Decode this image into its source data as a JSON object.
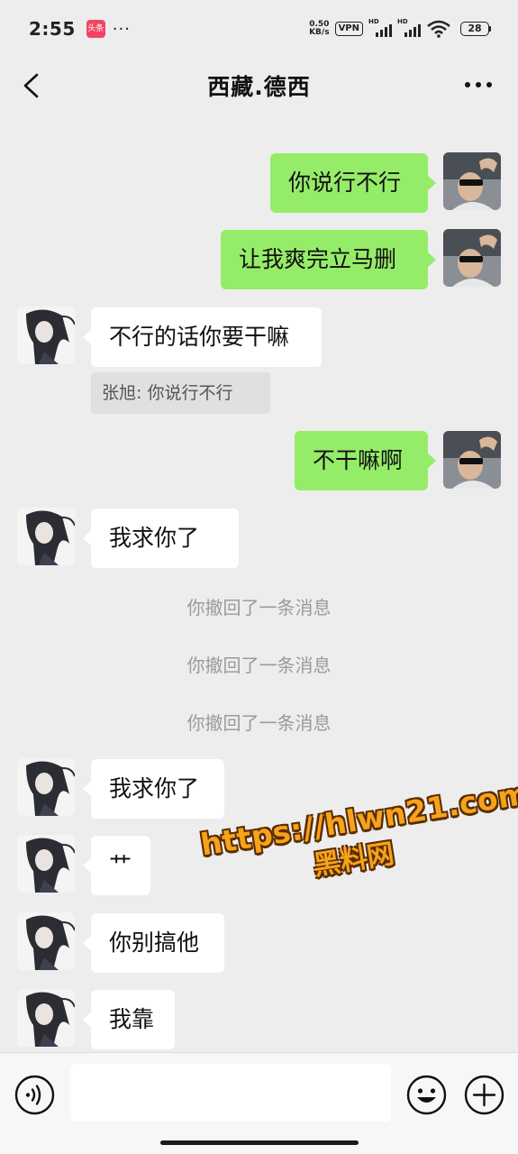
{
  "status_bar": {
    "time": "2:55",
    "app_badge": "头条",
    "more": "···",
    "net_speed_value": "0.50",
    "net_speed_unit": "KB/s",
    "vpn": "VPN",
    "hd1": "HD",
    "hd2": "HD",
    "battery": "28"
  },
  "header": {
    "title": "西藏.德西"
  },
  "messages": [
    {
      "side": "right",
      "text": "你说行不行",
      "avatar": "avatar-self"
    },
    {
      "side": "right",
      "text": "让我爽完立马删",
      "avatar": "avatar-self"
    },
    {
      "side": "left",
      "text": "不行的话你要干嘛",
      "avatar": "avatar-contact",
      "quote": "张旭: 你说行不行"
    },
    {
      "side": "right",
      "text": "不干嘛啊",
      "avatar": "avatar-self"
    },
    {
      "side": "left",
      "text": "我求你了",
      "avatar": "avatar-contact"
    },
    {
      "system": "你撤回了一条消息"
    },
    {
      "system": "你撤回了一条消息"
    },
    {
      "system": "你撤回了一条消息"
    },
    {
      "side": "left",
      "text": "我求你了",
      "avatar": "avatar-contact"
    },
    {
      "side": "left",
      "text": "艹",
      "avatar": "avatar-contact"
    },
    {
      "side": "left",
      "text": "你别搞他",
      "avatar": "avatar-contact"
    },
    {
      "side": "left",
      "text": "我靠",
      "avatar": "avatar-contact"
    }
  ],
  "watermark": {
    "line1": "https://hlwn21.com",
    "line2": "黑料网"
  },
  "input_bar": {
    "placeholder": "",
    "voice_icon": "voice-icon",
    "emoji_icon": "emoji-icon",
    "plus_icon": "plus-icon"
  },
  "colors": {
    "background": "#ededed",
    "bubble_self": "#95ec69",
    "bubble_other": "#ffffff",
    "system_text": "#9a9a9a"
  }
}
